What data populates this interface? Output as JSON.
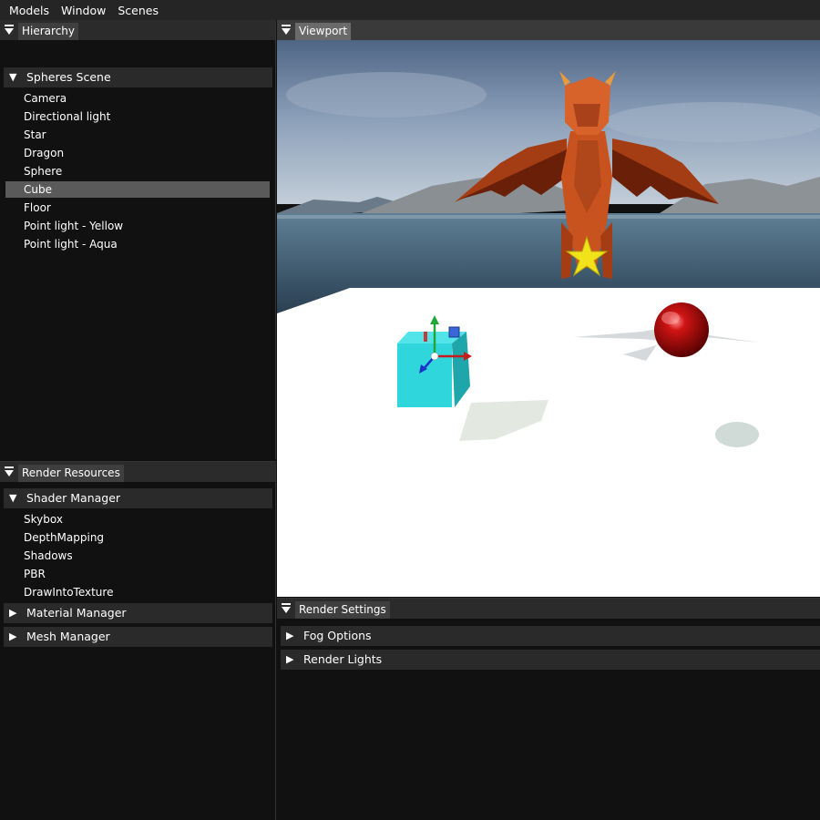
{
  "menubar": {
    "items": [
      "Models",
      "Window",
      "Scenes"
    ]
  },
  "hierarchy": {
    "tab_label": "Hierarchy",
    "scene_label": "Spheres Scene",
    "items": [
      {
        "label": "Camera"
      },
      {
        "label": "Directional light"
      },
      {
        "label": "Star"
      },
      {
        "label": "Dragon"
      },
      {
        "label": "Sphere"
      },
      {
        "label": "Cube",
        "selected": true
      },
      {
        "label": "Floor"
      },
      {
        "label": "Point light - Yellow"
      },
      {
        "label": "Point light - Aqua"
      }
    ]
  },
  "render_resources": {
    "tab_label": "Render Resources",
    "shader_manager": {
      "label": "Shader Manager",
      "items": [
        "Skybox",
        "DepthMapping",
        "Shadows",
        "PBR",
        "DrawIntoTexture"
      ]
    },
    "material_manager_label": "Material Manager",
    "mesh_manager_label": "Mesh Manager"
  },
  "viewport": {
    "tab_label": "Viewport"
  },
  "render_settings": {
    "tab_label": "Render Settings",
    "fog_options_label": "Fog Options",
    "render_lights_label": "Render Lights"
  },
  "colors": {
    "dragon": "#c8531f",
    "cube": "#2fd6dc",
    "sphere": "#b80c0c",
    "star": "#f2e21a",
    "floor": "#ffffff",
    "sky": "#7f97b3",
    "water": "#3f5f78"
  }
}
